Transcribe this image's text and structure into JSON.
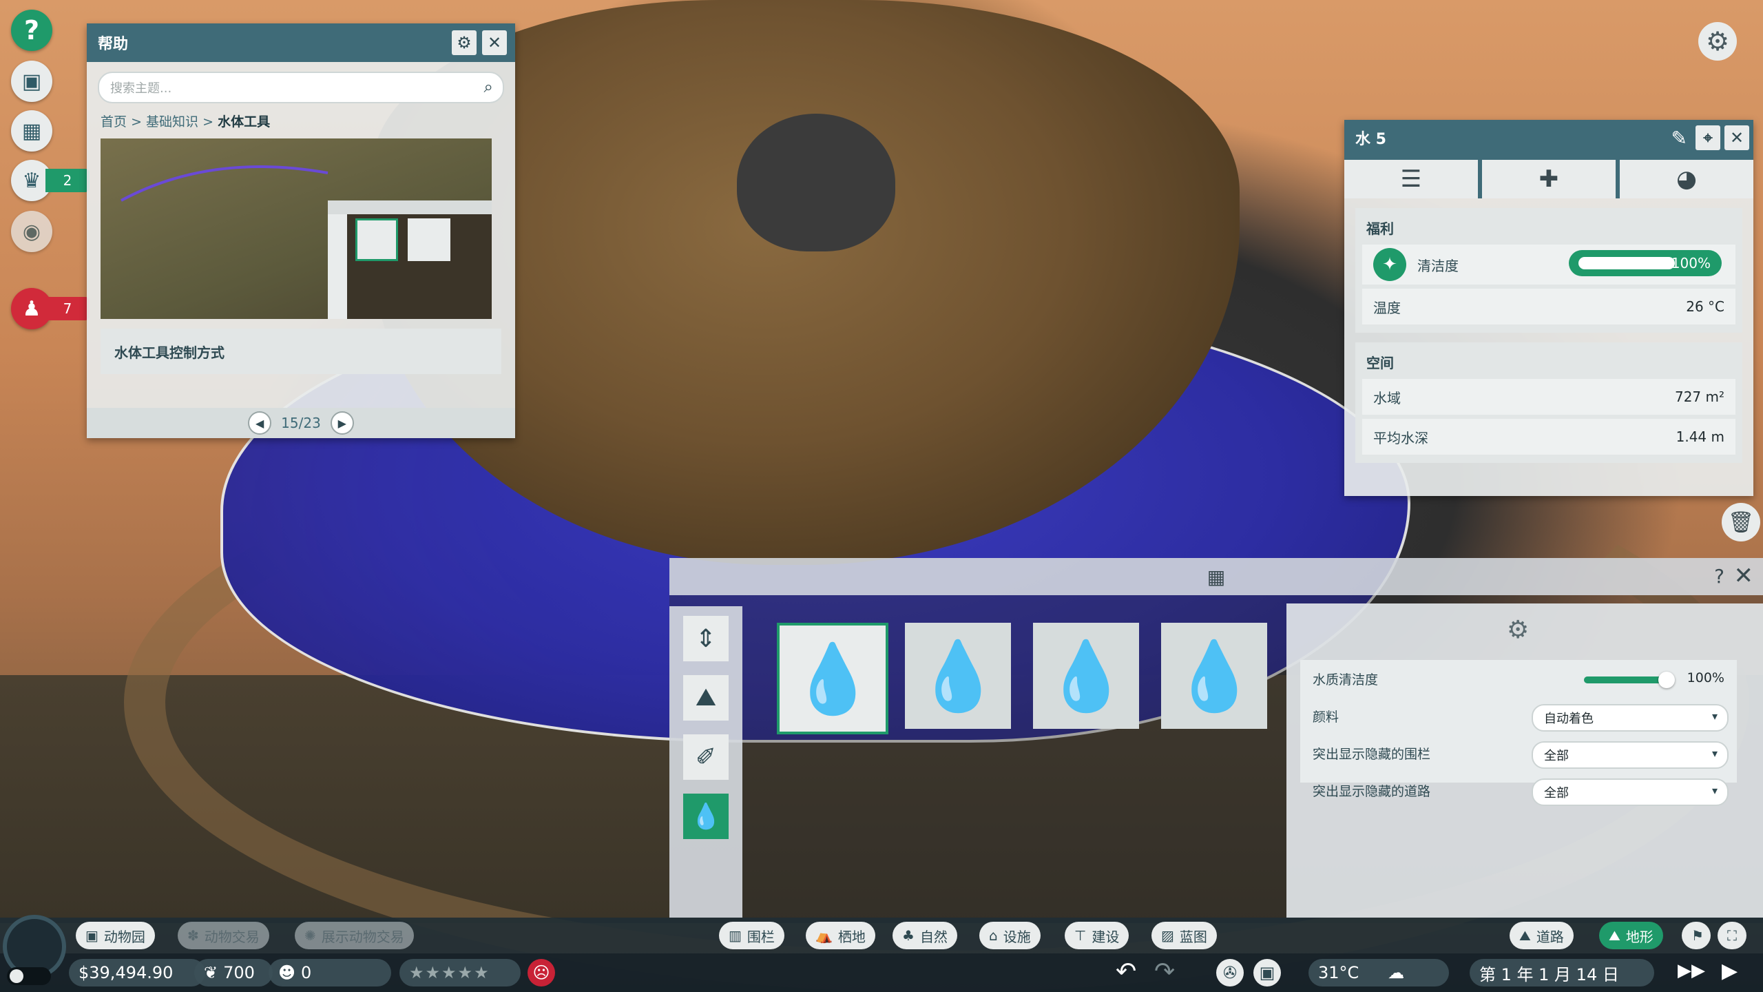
{
  "rail": {
    "help_icon": "?",
    "zoo_icon": "▣",
    "calendar_icon": "▦",
    "trophy_icon": "♛",
    "trophy_count": "2",
    "eye_icon": "◉",
    "staff_icon": "♟",
    "alert_count": "7",
    "accent": "#1f9a6a",
    "alert_color": "#d12a3a"
  },
  "help": {
    "title": "帮助",
    "gear_icon": "⚙",
    "close_icon": "✕",
    "search_placeholder": "搜索主题...",
    "search_icon": "⌕",
    "breadcrumb": {
      "home": "首页",
      "sep": ">",
      "section": "基础知识",
      "current": "水体工具"
    },
    "caption": "水体工具控制方式",
    "prev_icon": "◀",
    "next_icon": "▶",
    "page": "15/23"
  },
  "top_gear_icon": "⚙",
  "info": {
    "title": "水 5",
    "edit_icon": "✎",
    "locate_icon": "⌖",
    "close_icon": "✕",
    "tab_icons": [
      "☰",
      "✚",
      "◕"
    ],
    "welfare": {
      "title": "福利",
      "cleanliness_label": "清洁度",
      "cleanliness_icon": "✦",
      "cleanliness_value": "100%",
      "cleanliness_fraction": 1.0,
      "temp_label": "温度",
      "temp_value": "26 °C"
    },
    "space": {
      "title": "空间",
      "area_label": "水域",
      "area_value": "727 m²",
      "depth_label": "平均水深",
      "depth_value": "1.44 m"
    },
    "trash_icon": "🗑"
  },
  "tool": {
    "grid_icon": "▦",
    "help_icon": "?",
    "close_icon": "✕",
    "side_tools": [
      "⇕",
      "⛰",
      "✐",
      "💧"
    ],
    "cards": [
      "💧",
      "💧",
      "💧",
      "💧"
    ],
    "settings_icon": "⚙",
    "quality_label": "水质清洁度",
    "quality_value": "100%",
    "quality_fraction": 1.0,
    "pigment_label": "颜料",
    "pigment_value": "自动着色",
    "fences_label": "突出显示隐藏的围栏",
    "fences_value": "全部",
    "paths_label": "突出显示隐藏的道路",
    "paths_value": "全部",
    "chevron": "▾"
  },
  "bottom": {
    "left_tabs": [
      "动物园",
      "动物交易",
      "展示动物交易"
    ],
    "left_icons": [
      "▣",
      "✽",
      "✺"
    ],
    "center_tabs": [
      "围栏",
      "栖地",
      "自然",
      "设施",
      "建设",
      "蓝图"
    ],
    "center_icons": [
      "▥",
      "⛺",
      "♣",
      "⌂",
      "⊤",
      "▨"
    ],
    "right_tabs": [
      "道路",
      "地形"
    ],
    "right_icons": [
      "⛰",
      "⛰"
    ],
    "money": "$39,494.90",
    "conservation": "700",
    "guests": "0",
    "rating": "★★★★★",
    "mood_icon": "☹",
    "undo_icon": "↶",
    "redo_icon": "↷",
    "camera_icon": "✇",
    "photo_icon": "▣",
    "temperature": "31°C",
    "weather_icon": "☁",
    "date": "第 1 年 1 月 14 日",
    "speed_icons": [
      "▶▶",
      "▶"
    ],
    "tools_icons": [
      "⚑",
      "⛶"
    ]
  }
}
